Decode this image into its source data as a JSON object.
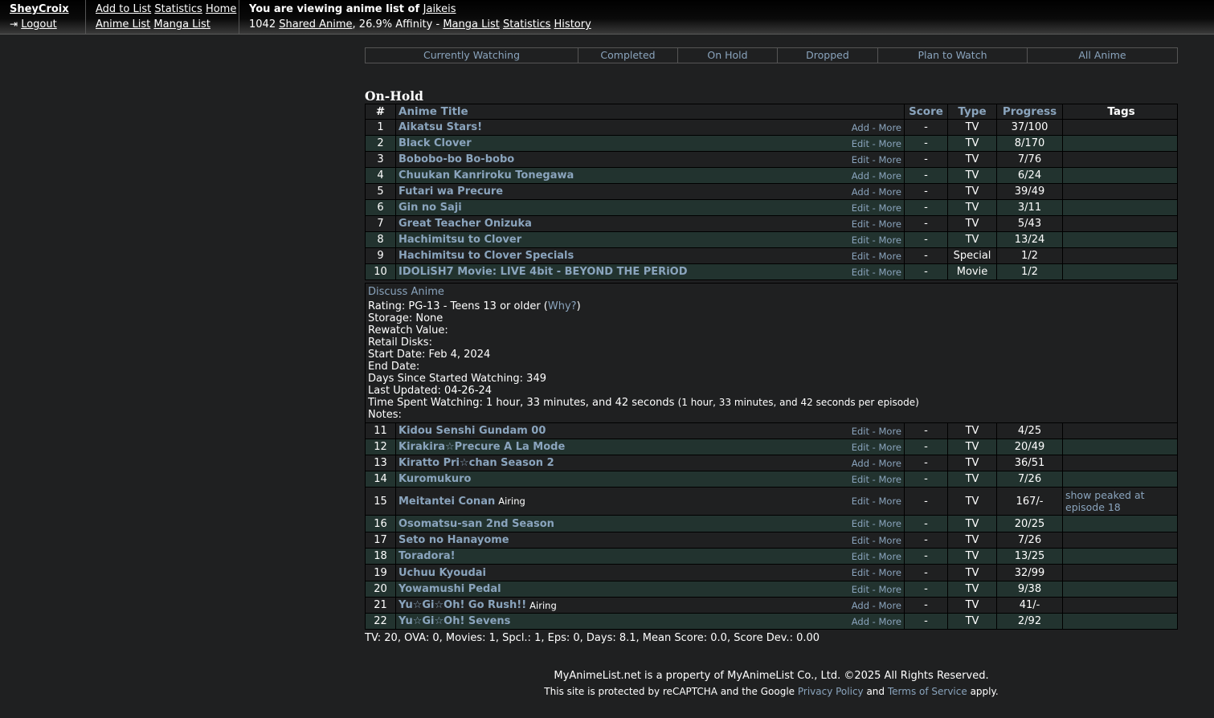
{
  "header": {
    "username": "SheyCroix",
    "logout": "Logout",
    "nav_row1": [
      "Add to List",
      "Statistics",
      "Home"
    ],
    "nav_row2": [
      "Anime List",
      "Manga List"
    ],
    "viewing_prefix": "You are viewing anime list of",
    "viewing_user": "Jaikeis",
    "shared_count": "1042",
    "shared_label": "Shared Anime",
    "affinity": ", 26.9% Affinity - ",
    "links": [
      "Manga List",
      "Statistics",
      "History"
    ]
  },
  "tabs": [
    "Currently Watching",
    "Completed",
    "On Hold",
    "Dropped",
    "Plan to Watch",
    "All Anime"
  ],
  "section_title": "On-Hold",
  "table_header": {
    "num": "#",
    "title": "Anime Title",
    "score": "Score",
    "type": "Type",
    "progress": "Progress",
    "tags": "Tags"
  },
  "rows_a": [
    {
      "num": "1",
      "title": "Aikatsu Stars!",
      "action": "Add",
      "more": "More",
      "score": "-",
      "type": "TV",
      "progress": "37/100",
      "tags": ""
    },
    {
      "num": "2",
      "title": "Black Clover",
      "action": "Edit",
      "more": "More",
      "score": "-",
      "type": "TV",
      "progress": "8/170",
      "tags": ""
    },
    {
      "num": "3",
      "title": "Bobobo-bo Bo-bobo",
      "action": "Edit",
      "more": "More",
      "score": "-",
      "type": "TV",
      "progress": "7/76",
      "tags": ""
    },
    {
      "num": "4",
      "title": "Chuukan Kanriroku Tonegawa",
      "action": "Add",
      "more": "More",
      "score": "-",
      "type": "TV",
      "progress": "6/24",
      "tags": ""
    },
    {
      "num": "5",
      "title": "Futari wa Precure",
      "action": "Add",
      "more": "More",
      "score": "-",
      "type": "TV",
      "progress": "39/49",
      "tags": ""
    },
    {
      "num": "6",
      "title": "Gin no Saji",
      "action": "Edit",
      "more": "More",
      "score": "-",
      "type": "TV",
      "progress": "3/11",
      "tags": ""
    },
    {
      "num": "7",
      "title": "Great Teacher Onizuka",
      "action": "Edit",
      "more": "More",
      "score": "-",
      "type": "TV",
      "progress": "5/43",
      "tags": ""
    },
    {
      "num": "8",
      "title": "Hachimitsu to Clover",
      "action": "Edit",
      "more": "More",
      "score": "-",
      "type": "TV",
      "progress": "13/24",
      "tags": ""
    },
    {
      "num": "9",
      "title": "Hachimitsu to Clover Specials",
      "action": "Edit",
      "more": "More",
      "score": "-",
      "type": "Special",
      "progress": "1/2",
      "tags": ""
    },
    {
      "num": "10",
      "title": "IDOLiSH7 Movie: LIVE 4bit - BEYOND THE PERiOD",
      "action": "Edit",
      "more": "More",
      "score": "-",
      "type": "Movie",
      "progress": "1/2",
      "tags": ""
    }
  ],
  "details": {
    "discuss": "Discuss Anime",
    "rating_prefix": "Rating: PG-13 - Teens 13 or older (",
    "rating_why": "Why?",
    "rating_suffix": ")",
    "storage": "Storage: None",
    "rewatch": "Rewatch Value:",
    "retail": "Retail Disks:",
    "start": "Start Date: Feb 4, 2024",
    "end": "End Date:",
    "days": "Days Since Started Watching: 349",
    "updated": "Last Updated: 04-26-24",
    "time_main": "Time Spent Watching: 1 hour, 33 minutes, and 42 seconds",
    "time_small": "(1 hour, 33 minutes, and 42 seconds per episode)",
    "notes": "Notes:"
  },
  "rows_b": [
    {
      "num": "11",
      "title": "Kidou Senshi Gundam 00",
      "airing": "",
      "action": "Edit",
      "more": "More",
      "score": "-",
      "type": "TV",
      "progress": "4/25",
      "tags": ""
    },
    {
      "num": "12",
      "title": "Kirakira☆Precure A La Mode",
      "airing": "",
      "action": "Edit",
      "more": "More",
      "score": "-",
      "type": "TV",
      "progress": "20/49",
      "tags": ""
    },
    {
      "num": "13",
      "title": "Kiratto Pri☆chan Season 2",
      "airing": "",
      "action": "Add",
      "more": "More",
      "score": "-",
      "type": "TV",
      "progress": "36/51",
      "tags": ""
    },
    {
      "num": "14",
      "title": "Kuromukuro",
      "airing": "",
      "action": "Edit",
      "more": "More",
      "score": "-",
      "type": "TV",
      "progress": "7/26",
      "tags": ""
    },
    {
      "num": "15",
      "title": "Meitantei Conan",
      "airing": "Airing",
      "action": "Edit",
      "more": "More",
      "score": "-",
      "type": "TV",
      "progress": "167/-",
      "tags": "show peaked at episode 18"
    },
    {
      "num": "16",
      "title": "Osomatsu-san 2nd Season",
      "airing": "",
      "action": "Edit",
      "more": "More",
      "score": "-",
      "type": "TV",
      "progress": "20/25",
      "tags": ""
    },
    {
      "num": "17",
      "title": "Seto no Hanayome",
      "airing": "",
      "action": "Edit",
      "more": "More",
      "score": "-",
      "type": "TV",
      "progress": "7/26",
      "tags": ""
    },
    {
      "num": "18",
      "title": "Toradora!",
      "airing": "",
      "action": "Edit",
      "more": "More",
      "score": "-",
      "type": "TV",
      "progress": "13/25",
      "tags": ""
    },
    {
      "num": "19",
      "title": "Uchuu Kyoudai",
      "airing": "",
      "action": "Edit",
      "more": "More",
      "score": "-",
      "type": "TV",
      "progress": "32/99",
      "tags": ""
    },
    {
      "num": "20",
      "title": "Yowamushi Pedal",
      "airing": "",
      "action": "Edit",
      "more": "More",
      "score": "-",
      "type": "TV",
      "progress": "9/38",
      "tags": ""
    },
    {
      "num": "21",
      "title": "Yu☆Gi☆Oh! Go Rush!!",
      "airing": "Airing",
      "action": "Add",
      "more": "More",
      "score": "-",
      "type": "TV",
      "progress": "41/-",
      "tags": ""
    },
    {
      "num": "22",
      "title": "Yu☆Gi☆Oh! Sevens",
      "airing": "",
      "action": "Add",
      "more": "More",
      "score": "-",
      "type": "TV",
      "progress": "2/92",
      "tags": ""
    }
  ],
  "summary": "TV: 20, OVA: 0, Movies: 1, Spcl.: 1, Eps: 0, Days: 8.1, Mean Score: 0.0, Score Dev.: 0.00",
  "footer": {
    "line1": "MyAnimeList.net is a property of MyAnimeList Co., Ltd. ©2025 All Rights Reserved.",
    "line2_prefix": "This site is protected by reCAPTCHA and the Google ",
    "privacy": "Privacy Policy",
    "and": " and ",
    "terms": "Terms of Service",
    "line2_suffix": " apply."
  },
  "colors": {
    "background": "#1f2021",
    "row_alt": "#22332f",
    "link": "#8aa4bd"
  }
}
